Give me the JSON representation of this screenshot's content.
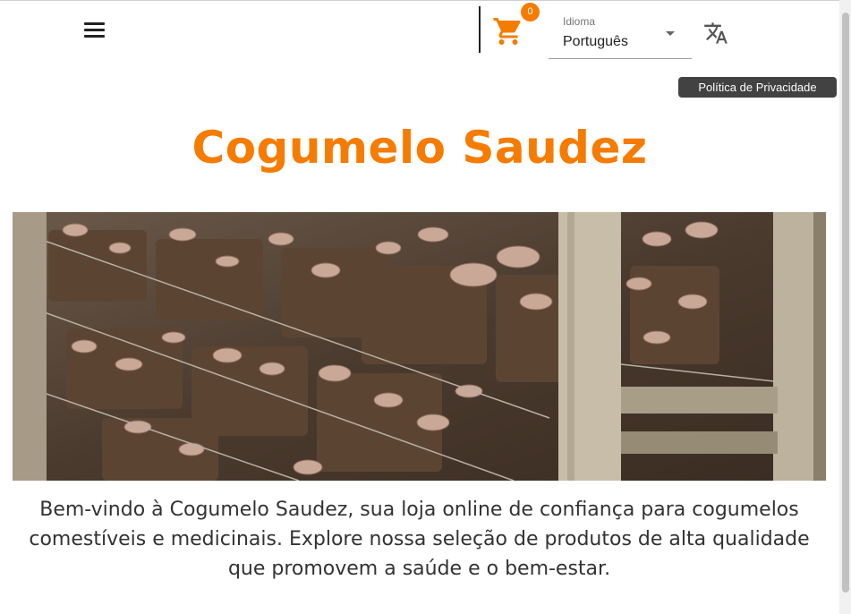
{
  "header": {
    "menu_icon": "hamburger-menu-icon",
    "cart": {
      "icon": "shopping-cart-icon",
      "count": "0"
    },
    "language": {
      "label": "Idioma",
      "value": "Português"
    },
    "translate_icon": "translate-icon",
    "tooltip": "Política de Privacidade"
  },
  "main": {
    "title": "Cogumelo Saudez",
    "hero_alt": "",
    "welcome_text": "Bem-vindo à Cogumelo Saudez, sua loja online de confiança para cogumelos comestíveis e medicinais. Explore nossa seleção de produtos de alta qualidade que promovem a saúde e o bem-estar."
  },
  "colors": {
    "accent": "#f57c00",
    "tooltip_bg": "#424242"
  }
}
